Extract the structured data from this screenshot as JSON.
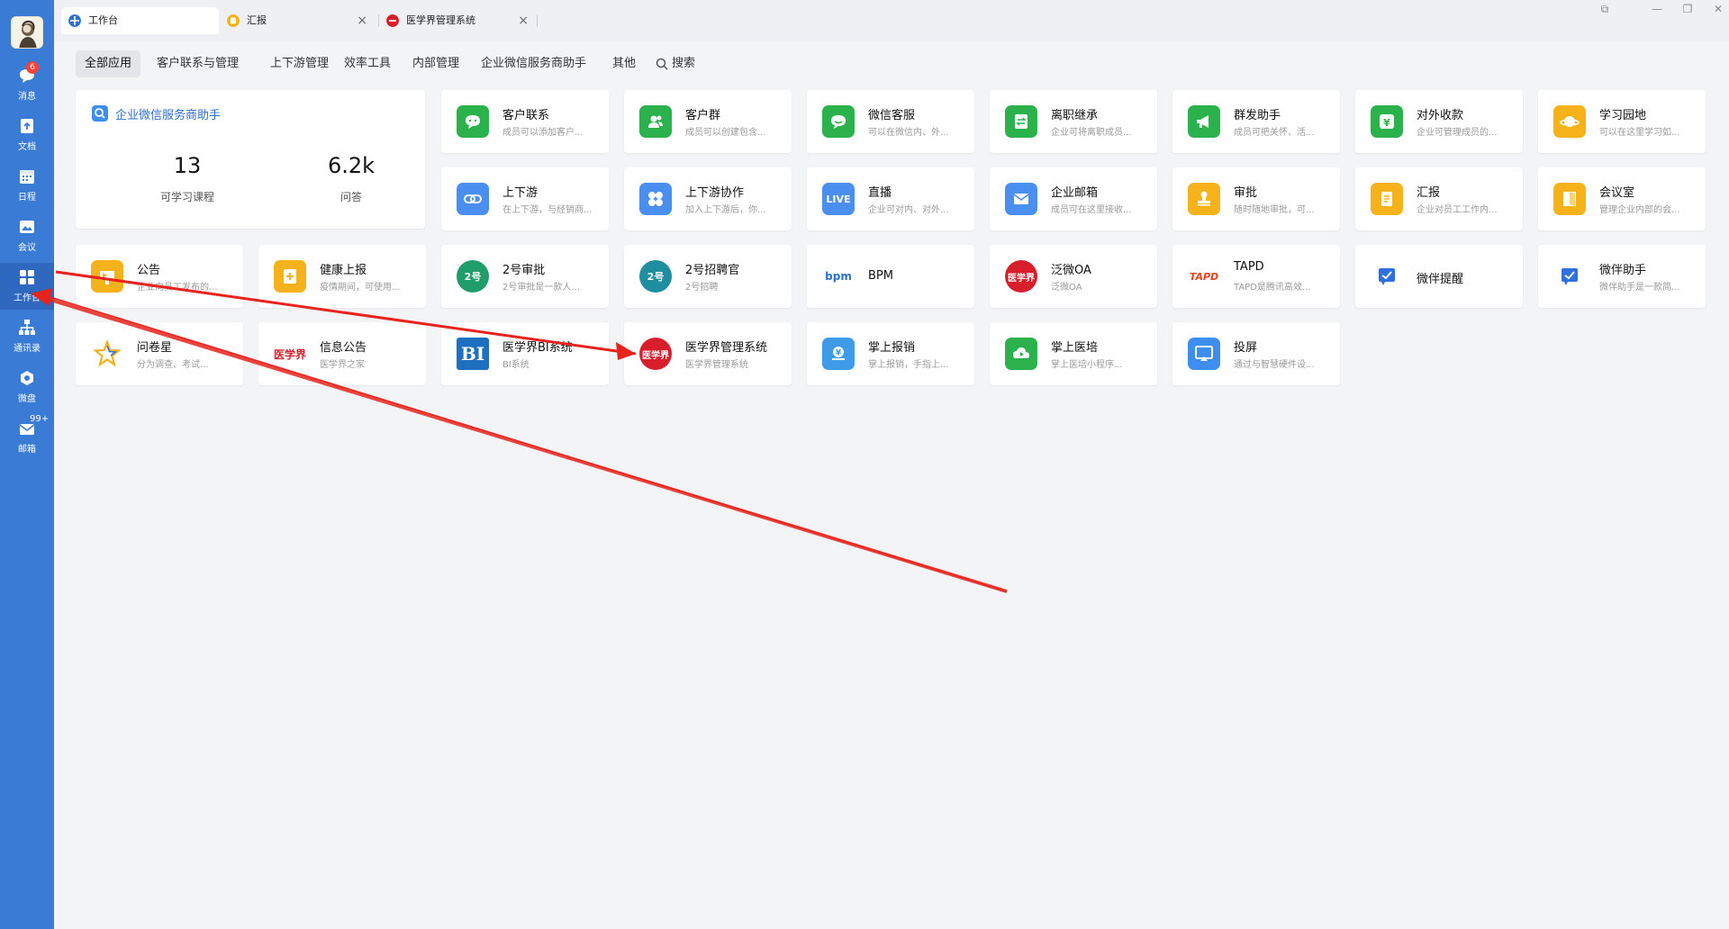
{
  "sidebar": {
    "items": [
      {
        "label": "消息",
        "icon": "chat-bubble-icon",
        "badge": "6"
      },
      {
        "label": "文档",
        "icon": "document-icon"
      },
      {
        "label": "日程",
        "icon": "calendar-icon"
      },
      {
        "label": "会议",
        "icon": "meeting-icon"
      },
      {
        "label": "工作台",
        "icon": "grid-icon",
        "active": true
      },
      {
        "label": "通讯录",
        "icon": "org-chart-icon"
      },
      {
        "label": "微盘",
        "icon": "cloud-drive-icon"
      },
      {
        "label": "邮箱",
        "icon": "mail-icon",
        "badge": "99+"
      }
    ]
  },
  "tabs": [
    {
      "label": "工作台",
      "icon": "workbench-icon",
      "active": true
    },
    {
      "label": "汇报",
      "icon": "report-icon",
      "close": "×"
    },
    {
      "label": "医学界管理系统",
      "icon": "yixuejie-logo-icon",
      "close": "×"
    }
  ],
  "categories": [
    "全部应用",
    "客户联系与管理",
    "上下游管理",
    "效率工具",
    "内部管理",
    "企业微信服务商助手",
    "其他",
    "搜索"
  ],
  "stats": {
    "title": "企业微信服务商助手",
    "items": [
      {
        "value": "13",
        "label": "可学习课程"
      },
      {
        "value": "6.2k",
        "label": "问答"
      }
    ]
  },
  "apps": [
    {
      "name": "客户联系",
      "desc": "成员可以添加客户...",
      "color": "#2bb24c",
      "icon": "chat-icon"
    },
    {
      "name": "客户群",
      "desc": "成员可以创建包含...",
      "color": "#2bb24c",
      "icon": "group-icon"
    },
    {
      "name": "微信客服",
      "desc": "可以在微信内、外...",
      "color": "#2bb24c",
      "icon": "wechat-service-icon"
    },
    {
      "name": "离职继承",
      "desc": "企业可将离职成员...",
      "color": "#2bb24c",
      "icon": "transfer-icon"
    },
    {
      "name": "群发助手",
      "desc": "成员可把关怀、活...",
      "color": "#2bb24c",
      "icon": "megaphone-icon"
    },
    {
      "name": "对外收款",
      "desc": "企业可管理成员的...",
      "color": "#2bb24c",
      "icon": "yen-icon"
    },
    {
      "name": "学习园地",
      "desc": "可以在这里学习如...",
      "color": "#f5b21b",
      "icon": "planet-icon"
    },
    {
      "name": "上下游",
      "desc": "在上下游，与经销商...",
      "color": "#4a8ff0",
      "icon": "link-icon"
    },
    {
      "name": "上下游协作",
      "desc": "加入上下游后，你...",
      "color": "#4a8ff0",
      "icon": "clover-icon"
    },
    {
      "name": "直播",
      "desc": "企业可对内、对外...",
      "color": "#4a8ff0",
      "icon": "live-icon",
      "text": "LIVE"
    },
    {
      "name": "企业邮箱",
      "desc": "成员可在这里接收...",
      "color": "#4a8ff0",
      "icon": "envelope-icon"
    },
    {
      "name": "审批",
      "desc": "随时随地审批，可...",
      "color": "#f5b21b",
      "icon": "stamp-icon"
    },
    {
      "name": "汇报",
      "desc": "企业对员工工作内...",
      "color": "#f5b21b",
      "icon": "report-doc-icon"
    },
    {
      "name": "会议室",
      "desc": "管理企业内部的会...",
      "color": "#f5b21b",
      "icon": "door-icon"
    },
    {
      "name": "公告",
      "desc": "企业向员工发布的...",
      "color": "#f5b21b",
      "icon": "announcement-icon"
    },
    {
      "name": "健康上报",
      "desc": "疫情期间，可使用...",
      "color": "#f5b21b",
      "icon": "health-icon"
    },
    {
      "name": "2号审批",
      "desc": "2号审批是一款人...",
      "color": "#1f9e6a",
      "icon": "approval2-icon",
      "text": "2号"
    },
    {
      "name": "2号招聘官",
      "desc": "2号招聘",
      "color": "#1f8fa0",
      "icon": "recruit2-icon",
      "text": "2号"
    },
    {
      "name": "BPM",
      "desc": "",
      "color": "#ffffff",
      "icon": "bpm-logo-icon",
      "text": "bpm"
    },
    {
      "name": "泛微OA",
      "desc": "泛微OA",
      "color": "#d81e2a",
      "icon": "yixuejie-logo-icon",
      "text": "医学界"
    },
    {
      "name": "TAPD",
      "desc": "TAPD是腾讯高效...",
      "color": "#ffffff",
      "icon": "tapd-logo-icon",
      "text": "TAPD"
    },
    {
      "name": "微伴提醒",
      "desc": "",
      "color": "#2f6fe0",
      "icon": "check-bubble-icon"
    },
    {
      "name": "微伴助手",
      "desc": "微伴助手是一款简...",
      "color": "#2f6fe0",
      "icon": "check-bubble-icon"
    },
    {
      "name": "问卷星",
      "desc": "分为调查、考试...",
      "color": "#ffffff",
      "icon": "star-icon"
    },
    {
      "name": "信息公告",
      "desc": "医学界之家",
      "color": "#ffffff",
      "icon": "yixuejie-text-logo-icon",
      "text": "医学界"
    },
    {
      "name": "医学界BI系统",
      "desc": "BI系统",
      "color": "#1e6fc0",
      "icon": "bi-logo-icon",
      "text": "BI"
    },
    {
      "name": "医学界管理系统",
      "desc": "医学界管理系统",
      "color": "#d81e2a",
      "icon": "yixuejie-logo-icon",
      "text": "医学界"
    },
    {
      "name": "掌上报销",
      "desc": "掌上报销，手指上...",
      "color": "#3d9be9",
      "icon": "reimburse-icon"
    },
    {
      "name": "掌上医培",
      "desc": "掌上医培小程序...",
      "color": "#2bb24c",
      "icon": "cloud-play-icon"
    },
    {
      "name": "投屏",
      "desc": "通过与智慧硬件设...",
      "color": "#3d8ef0",
      "icon": "screen-cast-icon"
    }
  ],
  "window_controls": [
    "⧉",
    "—",
    "❐",
    "✕"
  ]
}
